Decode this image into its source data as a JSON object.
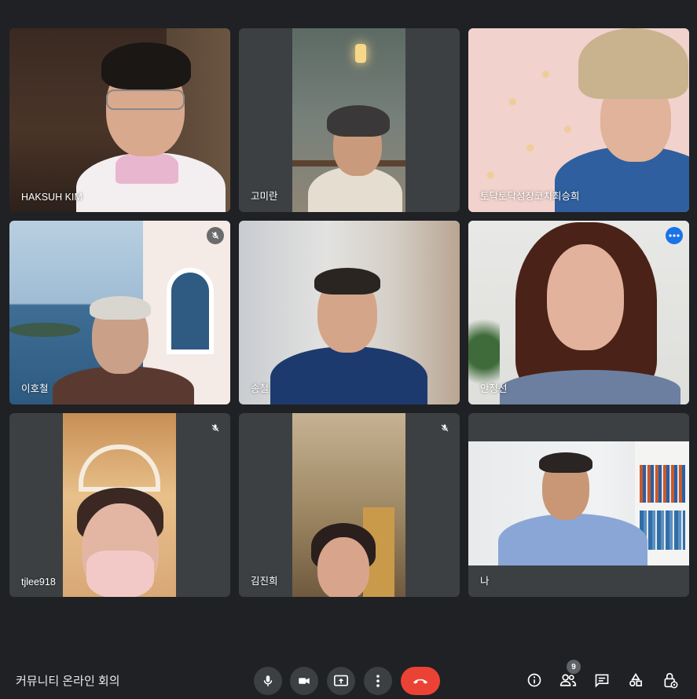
{
  "participants": [
    {
      "name": "HAKSUH KIM",
      "muted": false
    },
    {
      "name": "고미란",
      "muted": false
    },
    {
      "name": "토닥토닥성장코치최승희",
      "muted": false
    },
    {
      "name": "이호철",
      "muted": true
    },
    {
      "name": "송철",
      "muted": false
    },
    {
      "name": "안정선",
      "muted": false,
      "active_speaker": true
    },
    {
      "name": "tjlee918",
      "muted": true
    },
    {
      "name": "김진희",
      "muted": true
    },
    {
      "name": "나",
      "muted": false
    }
  ],
  "meeting": {
    "title": "커뮤니티 온라인 회의"
  },
  "controls": {
    "center": [
      "mic-icon",
      "camera-icon",
      "present-icon",
      "more-vert-icon",
      "end-call-icon"
    ],
    "right": [
      "info-icon",
      "people-icon",
      "chat-icon",
      "activities-icon",
      "host-controls-icon"
    ],
    "people_count": "9"
  },
  "colors": {
    "background": "#202124",
    "tile": "#3c4043",
    "end_call": "#ea4335",
    "active_outline": "#8ab4f8",
    "more_button": "#1a73e8"
  }
}
